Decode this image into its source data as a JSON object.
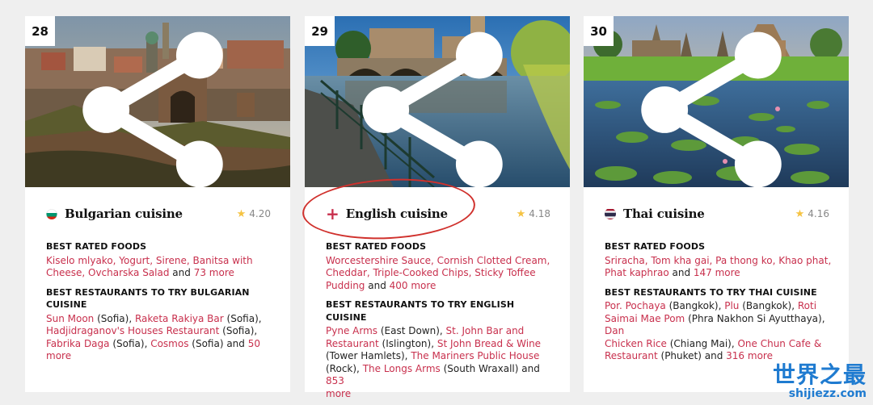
{
  "cards": [
    {
      "rank": "28",
      "name": "Bulgarian cuisine",
      "rating": "4.20",
      "flag": "bulgaria-flag-icon",
      "foods_heading": "BEST RATED FOODS",
      "foods": {
        "l1": "Kiselo mlyako, Yogurt, Sirene, Banitsa with",
        "l2a": "Cheese, Ovcharska Salad",
        "l2b": " and ",
        "l2c": "73 more"
      },
      "restaurants_heading": "BEST RESTAURANTS TO TRY BULGARIAN CUISINE",
      "restaurants": {
        "r1a": "Sun Moon",
        "r1b": " (Sofia), ",
        "r1c": "Raketa Rakiya Bar",
        "r1d": " (Sofia),",
        "r2a": "Hadjidraganov's Houses Restaurant",
        "r2b": " (Sofia),",
        "r3a": "Fabrika Daga",
        "r3b": " (Sofia), ",
        "r3c": "Cosmos",
        "r3d": " (Sofia) and ",
        "r3e": "50 more"
      }
    },
    {
      "rank": "29",
      "name": "English cuisine",
      "rating": "4.18",
      "flag": "england-cross-icon",
      "foods_heading": "BEST RATED FOODS",
      "foods": {
        "l1": "Worcestershire Sauce, Cornish Clotted Cream,",
        "l2": "Cheddar, Triple-Cooked Chips, Sticky Toffee",
        "l3a": "Pudding",
        "l3b": " and ",
        "l3c": "400 more"
      },
      "restaurants_heading": "BEST RESTAURANTS TO TRY ENGLISH CUISINE",
      "restaurants": {
        "r1a": "Pyne Arms",
        "r1b": " (East Down), ",
        "r1c": "St. John Bar and",
        "r2a": "Restaurant",
        "r2b": " (Islington), ",
        "r2c": "St John Bread & Wine",
        "r3a": "(Tower Hamlets), ",
        "r3b": "The Mariners Public House",
        "r4a": "(Rock), ",
        "r4b": "The Longs Arms",
        "r4c": " (South Wraxall) and ",
        "r4d": "853",
        "r5": "more"
      }
    },
    {
      "rank": "30",
      "name": "Thai cuisine",
      "rating": "4.16",
      "flag": "thailand-flag-icon",
      "foods_heading": "BEST RATED FOODS",
      "foods": {
        "l1": "Sriracha, Tom kha gai, Pa thong ko, Khao phat,",
        "l2a": "Phat kaphrao",
        "l2b": " and ",
        "l2c": "147 more"
      },
      "restaurants_heading": "BEST RESTAURANTS TO TRY THAI CUISINE",
      "restaurants": {
        "r1a": "Por. Pochaya",
        "r1b": " (Bangkok), ",
        "r1c": "Plu",
        "r1d": " (Bangkok), ",
        "r1e": "Roti",
        "r2a": "Saimai Mae Pom",
        "r2b": " (Phra Nakhon Si Ayutthaya), ",
        "r2c": "Dan",
        "r3a": "Chicken Rice",
        "r3b": " (Chiang Mai), ",
        "r3c": "One Chun Cafe &",
        "r4a": "Restaurant",
        "r4b": " (Phuket) and ",
        "r4c": "316 more"
      }
    }
  ],
  "watermark": {
    "main": "世界之最",
    "sub": "shijiezz.com"
  },
  "colors": {
    "link": "#c8304d",
    "annotation_circle": "#d0312d",
    "star": "#f5c342",
    "watermark": "#1f7bd0"
  }
}
